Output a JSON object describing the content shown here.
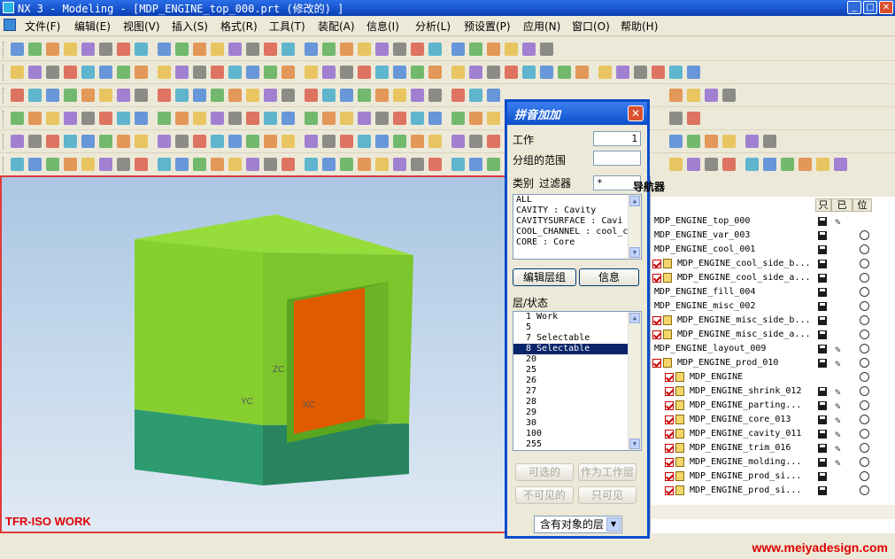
{
  "window": {
    "title": "NX 3 - Modeling - [MDP_ENGINE_top_000.prt  (修改的) ]"
  },
  "menu": {
    "items": [
      "文件(F)",
      "编辑(E)",
      "视图(V)",
      "插入(S)",
      "格式(R)",
      "工具(T)",
      "装配(A)",
      "信息(I)",
      "分析(L)",
      "预设置(P)",
      "应用(N)",
      "窗口(O)",
      "帮助(H)"
    ]
  },
  "viewport": {
    "work_label": "TFR-ISO WORK",
    "axis_zc": "ZC",
    "axis_yc": "YC",
    "axis_xc": "XC"
  },
  "watermark": "www.meiyadesign.com",
  "dialog": {
    "title": "拼音加加",
    "work_label": "工作",
    "work_value": "1",
    "range_label": "分组的范围",
    "range_value": "",
    "category_label": "类别",
    "filter_label": "过滤器",
    "filter_value": "*",
    "categories": [
      "ALL",
      "CAVITY : Cavity",
      "CAVITYSURFACE : Cavi",
      "COOL_CHANNEL : cool_c",
      "CORE : Core"
    ],
    "edit_group_button": "编辑层组",
    "info_button": "信息",
    "layer_state_label": "层/状态",
    "layers": [
      "1 Work",
      "5",
      "7 Selectable",
      "8 Selectable",
      "20",
      "25",
      "26",
      "27",
      "28",
      "29",
      "30",
      "100",
      "255"
    ],
    "selected_layer_index": 3,
    "selectable_button": "可选的",
    "make_work_button": "作为工作层",
    "invisible_button": "不可见的",
    "visible_only_button": "只可见",
    "filter_select": "含有对象的层"
  },
  "navigator": {
    "title": "导航器",
    "columns": [
      "只",
      "已",
      "位"
    ],
    "rows": [
      {
        "name": "MDP_ENGINE_top_000",
        "indent": 0,
        "checked": false,
        "saved": true,
        "edit": true,
        "radio": false
      },
      {
        "name": "MDP_ENGINE_var_003",
        "indent": 0,
        "checked": false,
        "saved": true,
        "edit": false,
        "radio": true
      },
      {
        "name": "MDP_ENGINE_cool_001",
        "indent": 0,
        "checked": false,
        "saved": true,
        "edit": false,
        "radio": true
      },
      {
        "name": "MDP_ENGINE_cool_side_b...",
        "indent": 1,
        "checked": true,
        "saved": true,
        "edit": false,
        "radio": true
      },
      {
        "name": "MDP_ENGINE_cool_side_a...",
        "indent": 1,
        "checked": true,
        "saved": true,
        "edit": false,
        "radio": true
      },
      {
        "name": "MDP_ENGINE_fill_004",
        "indent": 0,
        "checked": false,
        "saved": true,
        "edit": false,
        "radio": true
      },
      {
        "name": "MDP_ENGINE_misc_002",
        "indent": 0,
        "checked": false,
        "saved": true,
        "edit": false,
        "radio": true
      },
      {
        "name": "MDP_ENGINE_misc_side_b...",
        "indent": 1,
        "checked": true,
        "saved": true,
        "edit": false,
        "radio": true
      },
      {
        "name": "MDP_ENGINE_misc_side_a...",
        "indent": 1,
        "checked": true,
        "saved": true,
        "edit": false,
        "radio": true
      },
      {
        "name": "MDP_ENGINE_layout_009",
        "indent": 0,
        "checked": false,
        "saved": true,
        "edit": true,
        "radio": true
      },
      {
        "name": "MDP_ENGINE_prod_010",
        "indent": 1,
        "checked": true,
        "saved": true,
        "edit": true,
        "radio": true
      },
      {
        "name": "MDP_ENGINE",
        "indent": 2,
        "checked": true,
        "saved": false,
        "edit": false,
        "radio": true
      },
      {
        "name": "MDP_ENGINE_shrink_012",
        "indent": 2,
        "checked": true,
        "saved": true,
        "edit": true,
        "radio": true
      },
      {
        "name": "MDP_ENGINE_parting...",
        "indent": 2,
        "checked": true,
        "saved": true,
        "edit": true,
        "radio": true
      },
      {
        "name": "MDP_ENGINE_core_013",
        "indent": 2,
        "checked": true,
        "saved": true,
        "edit": true,
        "radio": true
      },
      {
        "name": "MDP_ENGINE_cavity_011",
        "indent": 2,
        "checked": true,
        "saved": true,
        "edit": true,
        "radio": true
      },
      {
        "name": "MDP_ENGINE_trim_016",
        "indent": 2,
        "checked": true,
        "saved": true,
        "edit": true,
        "radio": true
      },
      {
        "name": "MDP_ENGINE_molding...",
        "indent": 2,
        "checked": true,
        "saved": true,
        "edit": true,
        "radio": true
      },
      {
        "name": "MDP_ENGINE_prod_si...",
        "indent": 2,
        "checked": true,
        "saved": true,
        "edit": false,
        "radio": true
      },
      {
        "name": "MDP_ENGINE_prod_si...",
        "indent": 2,
        "checked": true,
        "saved": true,
        "edit": false,
        "radio": true
      }
    ]
  },
  "colors": {
    "title_blue": "#0a4ccb",
    "part_green": "#8fd63a",
    "part_base": "#2e9a6f",
    "core_orange": "#e05a00"
  }
}
